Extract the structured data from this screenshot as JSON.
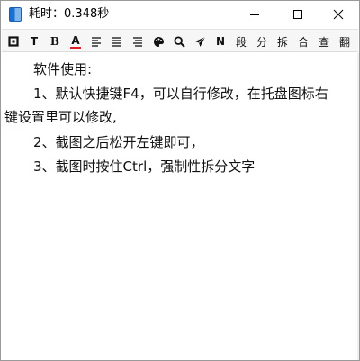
{
  "window": {
    "title": "耗时：0.348秒"
  },
  "titlebar_buttons": {
    "minimize_icon": "minimize-icon",
    "maximize_icon": "maximize-icon",
    "close_icon": "close-icon"
  },
  "toolbar": {
    "items": [
      {
        "name": "frame-icon",
        "label": ""
      },
      {
        "name": "text-T-icon",
        "label": "T"
      },
      {
        "name": "bold-icon",
        "label": "B"
      },
      {
        "name": "font-color-icon",
        "label": "A"
      },
      {
        "name": "align-left-icon",
        "label": ""
      },
      {
        "name": "align-center-icon",
        "label": ""
      },
      {
        "name": "align-right-icon",
        "label": ""
      },
      {
        "name": "palette-icon",
        "label": ""
      },
      {
        "name": "search-icon",
        "label": ""
      },
      {
        "name": "send-icon",
        "label": ""
      },
      {
        "name": "N-icon",
        "label": "N"
      }
    ],
    "text_buttons": [
      "段",
      "分",
      "拆",
      "合",
      "查",
      "翻"
    ],
    "font_color_accent": "#e02020"
  },
  "content": {
    "lines": [
      "软件使用:",
      "1、默认快捷键F4，可以自行修改，在托盘图标右",
      "键设置里可以修改,",
      "2、截图之后松开左键即可，",
      "3、截图时按住Ctrl，强制性拆分文字"
    ]
  }
}
